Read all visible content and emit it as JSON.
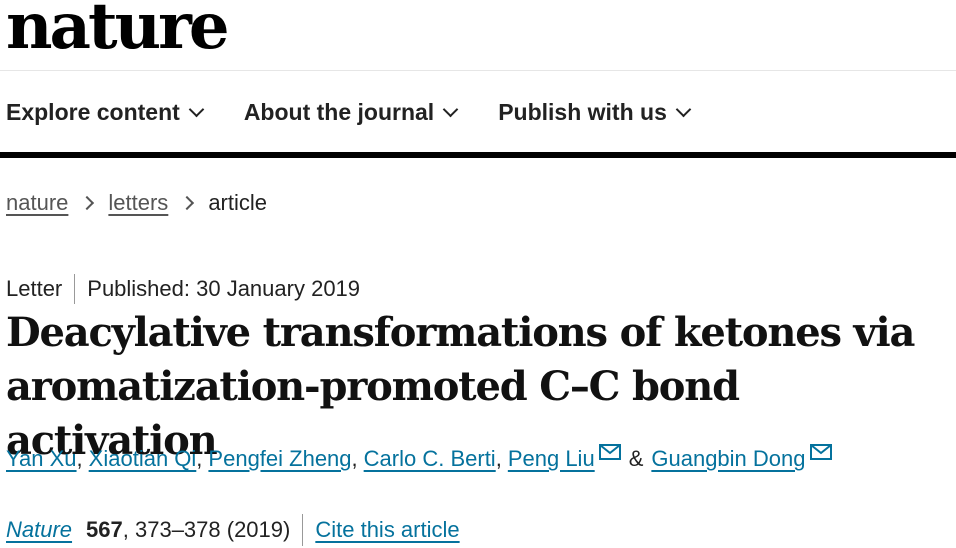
{
  "header": {
    "logo_text": "nature"
  },
  "nav": {
    "items": [
      {
        "label": "Explore content"
      },
      {
        "label": "About the journal"
      },
      {
        "label": "Publish with us"
      }
    ]
  },
  "breadcrumb": {
    "items": [
      {
        "label": "nature"
      },
      {
        "label": "letters"
      },
      {
        "label": "article"
      }
    ]
  },
  "article": {
    "type": "Letter",
    "published": "Published: 30 January 2019",
    "title": "Deacylative transformations of ketones via aromatization-promoted C–C bond activation",
    "authors": [
      {
        "name": "Yan Xu"
      },
      {
        "name": "Xiaotian Qi"
      },
      {
        "name": "Pengfei Zheng"
      },
      {
        "name": "Carlo C. Berti"
      },
      {
        "name": "Peng Liu"
      },
      {
        "name": "Guangbin Dong"
      }
    ],
    "author_separator": ",",
    "author_conjunction": "&",
    "citation": {
      "journal": "Nature",
      "volume": "567",
      "pages_year": ", 373–378 (2019)",
      "cite_label": "Cite this article"
    }
  },
  "colors": {
    "link": "#05729d",
    "text": "#222222",
    "rule": "#000000"
  },
  "icons": {
    "nav_dropdown": "chevron-down-icon",
    "breadcrumb_separator": "chevron-right-icon",
    "author_contact": "mail-icon"
  }
}
